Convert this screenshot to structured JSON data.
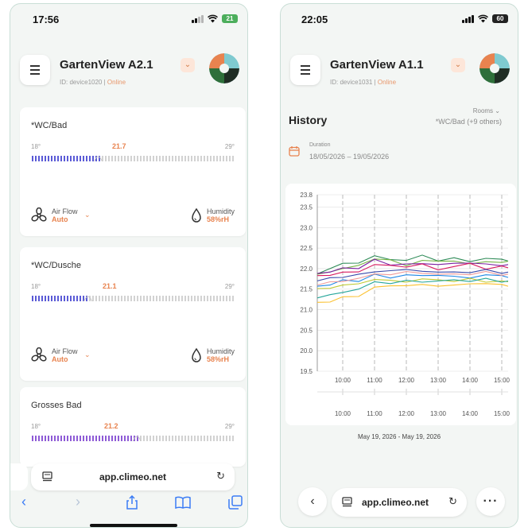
{
  "left_screen": {
    "status": {
      "time": "17:56",
      "battery": "21"
    },
    "header": {
      "title": "GartenView A2.1",
      "device_id": "ID: device1020",
      "separator": "|",
      "status": "Online",
      "dropdown_icon": "chevron-down-icon"
    },
    "rooms": [
      {
        "name": "*WC/Bad",
        "min": "18°",
        "max": "29°",
        "current": "21.7",
        "level": 0.33,
        "air_flow_label": "Air Flow",
        "air_flow_value": "Auto",
        "humidity_label": "Humidity",
        "humidity_value": "58%rH"
      },
      {
        "name": "*WC/Dusche",
        "min": "18°",
        "max": "29°",
        "current": "21.1",
        "level": 0.28,
        "air_flow_label": "Air Flow",
        "air_flow_value": "Auto",
        "humidity_label": "Humidity",
        "humidity_value": "58%rH"
      },
      {
        "name": "Grosses Bad",
        "min": "18°",
        "max": "29°",
        "current": "21.2",
        "level": 0.52
      }
    ],
    "browser": {
      "url": "app.climeo.net"
    }
  },
  "right_screen": {
    "status": {
      "time": "22:05",
      "battery": "60"
    },
    "header": {
      "title": "GartenView A1.1",
      "device_id": "ID: device1031",
      "separator": "|",
      "status": "Online"
    },
    "history": {
      "title": "History",
      "rooms_label": "Rooms",
      "rooms_value": "*WC/Bad (+9 others)",
      "duration_label": "Duration",
      "duration_value": "18/05/2026 – 19/05/2026"
    },
    "chart_caption": "May 19, 2026 - May 19, 2026",
    "browser": {
      "url": "app.climeo.net"
    }
  },
  "chart_data": {
    "type": "line",
    "title": "",
    "xlabel": "",
    "ylabel": "",
    "x_ticks": [
      "10:00",
      "11:00",
      "12:00",
      "13:00",
      "14:00",
      "15:00"
    ],
    "y_ticks": [
      "23.8",
      "23.5",
      "23.0",
      "22.5",
      "22.0",
      "21.5",
      "21.0",
      "20.5",
      "20.0",
      "19.5"
    ],
    "ylim": [
      19.5,
      23.8
    ],
    "xlim": [
      9.2,
      15.2
    ],
    "grid": true,
    "series": [
      {
        "color": "#2e8b57",
        "values": [
          [
            9.2,
            21.9
          ],
          [
            9.6,
            22.0
          ],
          [
            10.0,
            22.1
          ],
          [
            10.5,
            22.15
          ],
          [
            11.0,
            22.3
          ],
          [
            11.5,
            22.25
          ],
          [
            12.0,
            22.2
          ],
          [
            12.5,
            22.3
          ],
          [
            13.0,
            22.2
          ],
          [
            13.5,
            22.25
          ],
          [
            14.0,
            22.2
          ],
          [
            14.5,
            22.25
          ],
          [
            15.0,
            22.2
          ],
          [
            15.2,
            22.2
          ]
        ]
      },
      {
        "color": "#7ab648",
        "values": [
          [
            9.2,
            21.85
          ],
          [
            9.6,
            21.95
          ],
          [
            10.0,
            22.0
          ],
          [
            10.5,
            22.05
          ],
          [
            11.0,
            22.25
          ],
          [
            11.5,
            22.2
          ],
          [
            12.0,
            22.1
          ],
          [
            12.5,
            22.2
          ],
          [
            13.0,
            22.15
          ],
          [
            13.5,
            22.2
          ],
          [
            14.0,
            22.1
          ],
          [
            14.5,
            22.2
          ],
          [
            15.0,
            22.15
          ],
          [
            15.2,
            22.15
          ]
        ]
      },
      {
        "color": "#7b1fa2",
        "values": [
          [
            9.2,
            21.9
          ],
          [
            9.6,
            21.9
          ],
          [
            10.0,
            22.05
          ],
          [
            10.5,
            22.0
          ],
          [
            11.0,
            22.2
          ],
          [
            11.5,
            22.1
          ],
          [
            12.0,
            22.1
          ],
          [
            12.5,
            22.15
          ],
          [
            13.0,
            22.1
          ],
          [
            13.5,
            22.1
          ],
          [
            14.0,
            22.15
          ],
          [
            14.5,
            22.1
          ],
          [
            15.0,
            22.1
          ],
          [
            15.2,
            22.1
          ]
        ]
      },
      {
        "color": "#d81b60",
        "values": [
          [
            9.2,
            21.8
          ],
          [
            9.6,
            21.85
          ],
          [
            10.0,
            21.9
          ],
          [
            10.5,
            21.95
          ],
          [
            11.0,
            22.1
          ],
          [
            11.5,
            22.05
          ],
          [
            12.0,
            22.05
          ],
          [
            12.5,
            22.1
          ],
          [
            13.0,
            22.0
          ],
          [
            13.5,
            22.05
          ],
          [
            14.0,
            22.1
          ],
          [
            14.5,
            22.0
          ],
          [
            15.0,
            22.05
          ],
          [
            15.2,
            22.05
          ]
        ]
      },
      {
        "color": "#3949ab",
        "values": [
          [
            9.2,
            21.7
          ],
          [
            9.6,
            21.75
          ],
          [
            10.0,
            21.8
          ],
          [
            10.5,
            21.85
          ],
          [
            11.0,
            21.95
          ],
          [
            11.5,
            21.95
          ],
          [
            12.0,
            21.95
          ],
          [
            12.5,
            21.95
          ],
          [
            13.0,
            21.9
          ],
          [
            13.5,
            21.95
          ],
          [
            14.0,
            21.9
          ],
          [
            14.5,
            21.95
          ],
          [
            15.0,
            21.9
          ],
          [
            15.2,
            21.9
          ]
        ]
      },
      {
        "color": "#1e88e5",
        "values": [
          [
            9.2,
            21.6
          ],
          [
            9.6,
            21.6
          ],
          [
            10.0,
            21.7
          ],
          [
            10.5,
            21.7
          ],
          [
            11.0,
            21.85
          ],
          [
            11.5,
            21.8
          ],
          [
            12.0,
            21.85
          ],
          [
            12.5,
            21.8
          ],
          [
            13.0,
            21.85
          ],
          [
            13.5,
            21.8
          ],
          [
            14.0,
            21.8
          ],
          [
            14.5,
            21.85
          ],
          [
            15.0,
            21.8
          ],
          [
            15.2,
            21.8
          ]
        ]
      },
      {
        "color": "#c0ca33",
        "values": [
          [
            9.2,
            21.5
          ],
          [
            9.6,
            21.55
          ],
          [
            10.0,
            21.6
          ],
          [
            10.5,
            21.6
          ],
          [
            11.0,
            21.75
          ],
          [
            11.5,
            21.7
          ],
          [
            12.0,
            21.7
          ],
          [
            12.5,
            21.75
          ],
          [
            13.0,
            21.7
          ],
          [
            13.5,
            21.7
          ],
          [
            14.0,
            21.75
          ],
          [
            14.5,
            21.7
          ],
          [
            15.0,
            21.7
          ],
          [
            15.2,
            21.65
          ]
        ]
      },
      {
        "color": "#26a69a",
        "values": [
          [
            9.2,
            21.3
          ],
          [
            9.6,
            21.35
          ],
          [
            10.0,
            21.45
          ],
          [
            10.5,
            21.5
          ],
          [
            11.0,
            21.65
          ],
          [
            11.5,
            21.65
          ],
          [
            12.0,
            21.7
          ],
          [
            12.5,
            21.7
          ],
          [
            13.0,
            21.7
          ],
          [
            13.5,
            21.7
          ],
          [
            14.0,
            21.7
          ],
          [
            14.5,
            21.75
          ],
          [
            15.0,
            21.7
          ],
          [
            15.2,
            21.7
          ]
        ]
      },
      {
        "color": "#fbc02d",
        "values": [
          [
            9.2,
            21.15
          ],
          [
            9.6,
            21.2
          ],
          [
            10.0,
            21.3
          ],
          [
            10.5,
            21.35
          ],
          [
            11.0,
            21.55
          ],
          [
            11.5,
            21.55
          ],
          [
            12.0,
            21.6
          ],
          [
            12.5,
            21.6
          ],
          [
            13.0,
            21.6
          ],
          [
            13.5,
            21.6
          ],
          [
            14.0,
            21.6
          ],
          [
            14.5,
            21.65
          ],
          [
            15.0,
            21.6
          ],
          [
            15.2,
            21.6
          ]
        ]
      },
      {
        "color": "#ef9a9a",
        "values": [
          [
            9.2,
            21.6
          ],
          [
            9.6,
            21.65
          ],
          [
            10.0,
            21.7
          ],
          [
            10.5,
            21.75
          ],
          [
            11.0,
            21.9
          ],
          [
            11.5,
            21.85
          ],
          [
            12.0,
            21.9
          ],
          [
            12.5,
            21.9
          ],
          [
            13.0,
            21.85
          ],
          [
            13.5,
            21.9
          ],
          [
            14.0,
            21.85
          ],
          [
            14.5,
            21.9
          ],
          [
            15.0,
            21.85
          ],
          [
            15.2,
            21.85
          ]
        ]
      }
    ]
  }
}
